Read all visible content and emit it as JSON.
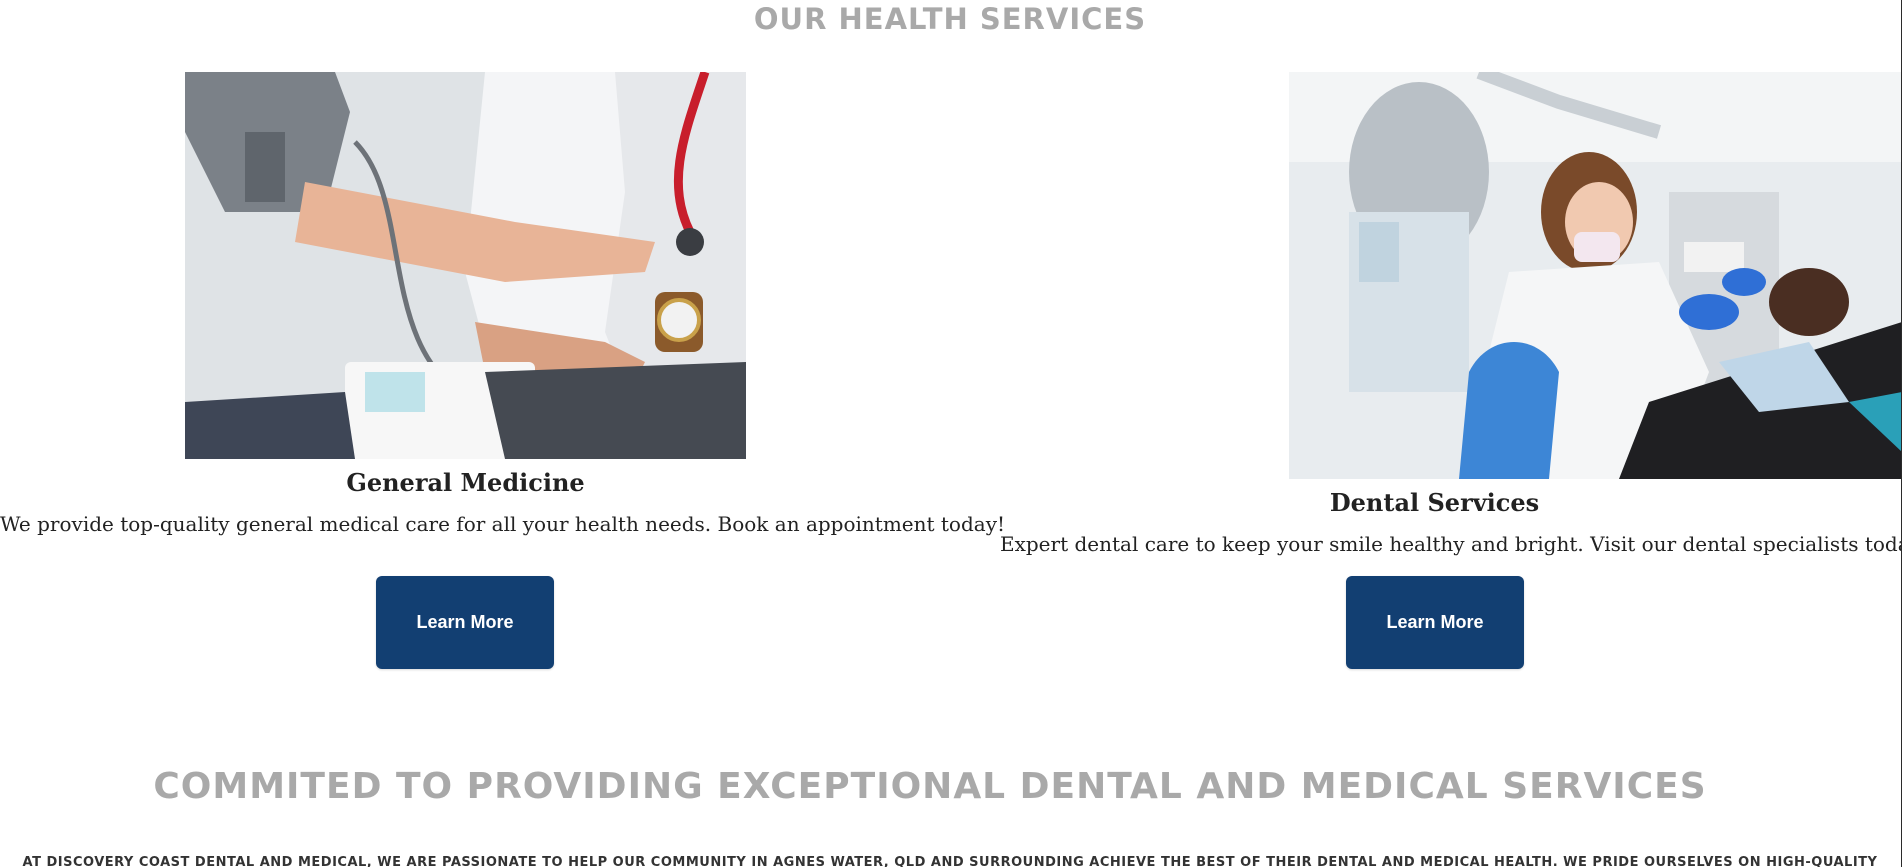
{
  "services_section": {
    "title": "OUR HEALTH SERVICES",
    "cards": [
      {
        "heading": "General Medicine",
        "description": "We provide top-quality general medical care for all your health needs. Book an appointment today!",
        "button_label": "Learn More",
        "image_icon": "blood-pressure-check-photo"
      },
      {
        "heading": "Dental Services",
        "description": "Expert dental care to keep your smile healthy and bright. Visit our dental specialists today!",
        "button_label": "Learn More",
        "image_icon": "dentist-patient-photo"
      }
    ]
  },
  "commitment_section": {
    "title": "COMMITED TO PROVIDING EXCEPTIONAL DENTAL AND MEDICAL SERVICES",
    "text": "AT DISCOVERY COAST DENTAL AND MEDICAL, WE ARE PASSIONATE TO HELP OUR COMMUNITY IN AGNES WATER, QLD AND SURROUNDING ACHIEVE THE BEST OF THEIR DENTAL AND MEDICAL HEALTH. WE PRIDE OURSELVES ON HIGH-QUALITY"
  },
  "colors": {
    "button_bg": "#123f72",
    "button_text": "#ffffff",
    "title_gray": "#a9a9a9",
    "body_text": "#222222"
  }
}
